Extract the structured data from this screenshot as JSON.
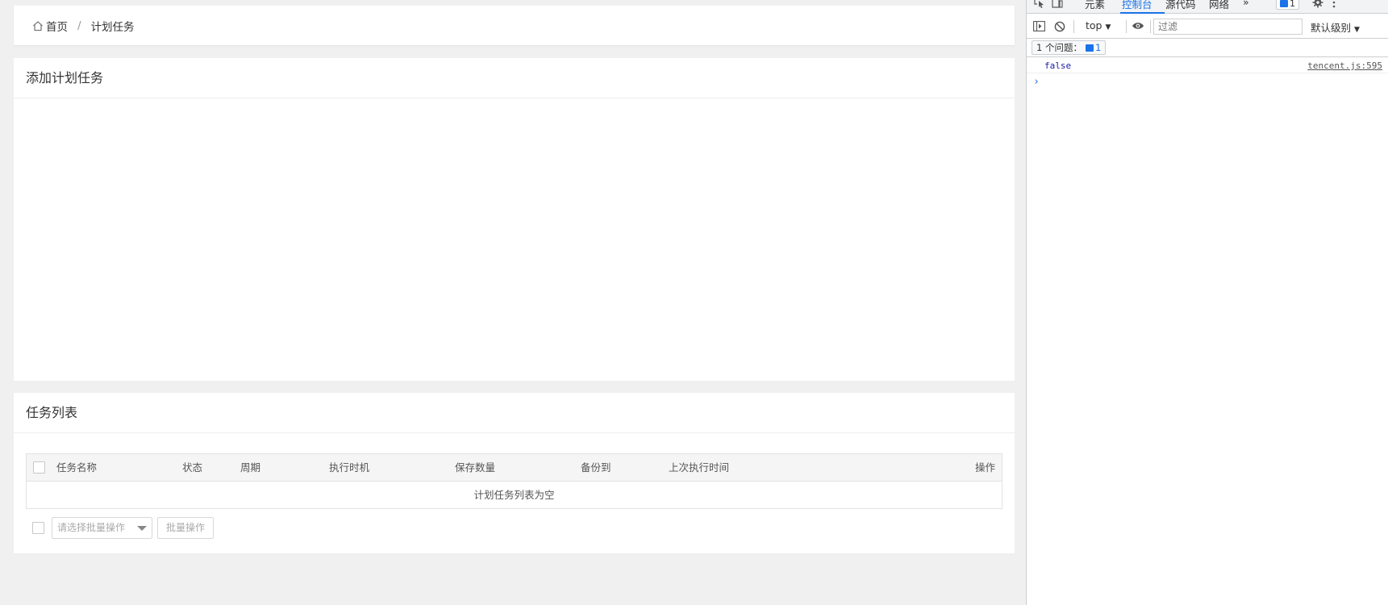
{
  "breadcrumb": {
    "home": "首页",
    "separator": "/",
    "current": "计划任务"
  },
  "add_panel": {
    "title": "添加计划任务"
  },
  "list_panel": {
    "title": "任务列表",
    "columns": [
      "任务名称",
      "状态",
      "周期",
      "执行时机",
      "保存数量",
      "备份到",
      "上次执行时间",
      "操作"
    ],
    "empty_text": "计划任务列表为空",
    "batch_select_placeholder": "请选择批量操作",
    "batch_button": "批量操作"
  },
  "devtools": {
    "tabs": [
      "元素",
      "控制台",
      "源代码",
      "网络"
    ],
    "active_tab": "控制台",
    "more_tabs": "»",
    "issue_badge_count": "1",
    "context": "top",
    "filter_placeholder": "过滤",
    "level": "默认级别",
    "issues_label": "1 个问题：",
    "issues_count": "1",
    "console": {
      "value": "false",
      "source": "tencent.js:595"
    },
    "prompt": "›"
  },
  "colors": {
    "accent": "#1a73e8",
    "page_bg": "#f0f0f0"
  }
}
